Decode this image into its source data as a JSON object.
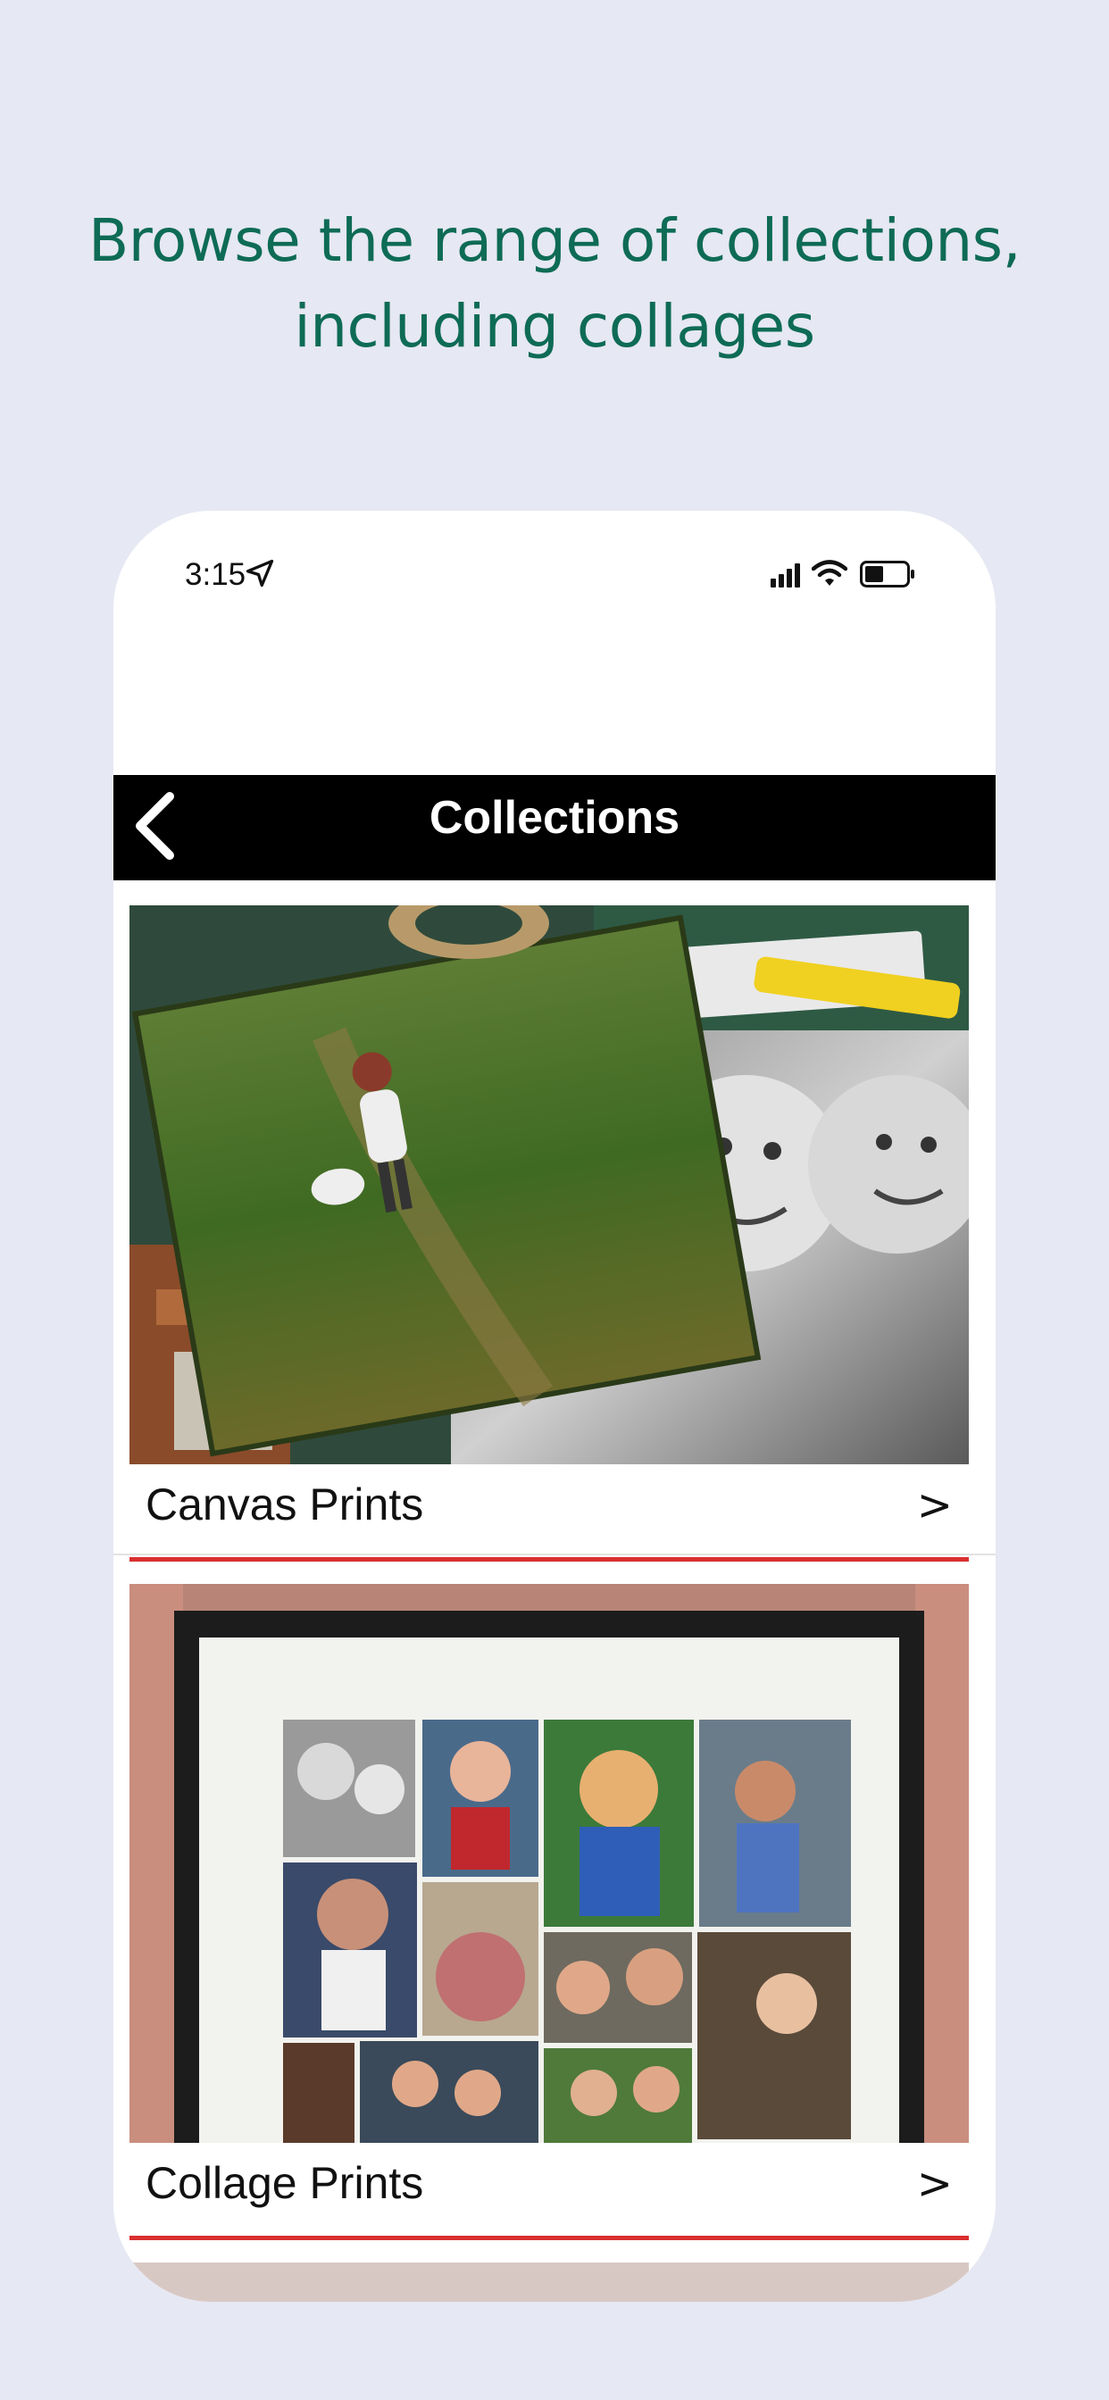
{
  "headline": {
    "line1": "Browse the range of collections,",
    "line2": "including collages"
  },
  "status_bar": {
    "time": "3:15",
    "icons": [
      "location-arrow-icon",
      "cellular-signal-icon",
      "wifi-icon",
      "battery-icon"
    ]
  },
  "nav": {
    "title": "Collections",
    "back_icon": "chevron-left-icon"
  },
  "collections": [
    {
      "label": "Canvas Prints",
      "arrow": ">"
    },
    {
      "label": "Collage Prints",
      "arrow": ">"
    }
  ],
  "colors": {
    "background": "#e6e8f3",
    "headline": "#0e6b55",
    "navbar": "#000000",
    "accent_line": "#d9302f"
  }
}
